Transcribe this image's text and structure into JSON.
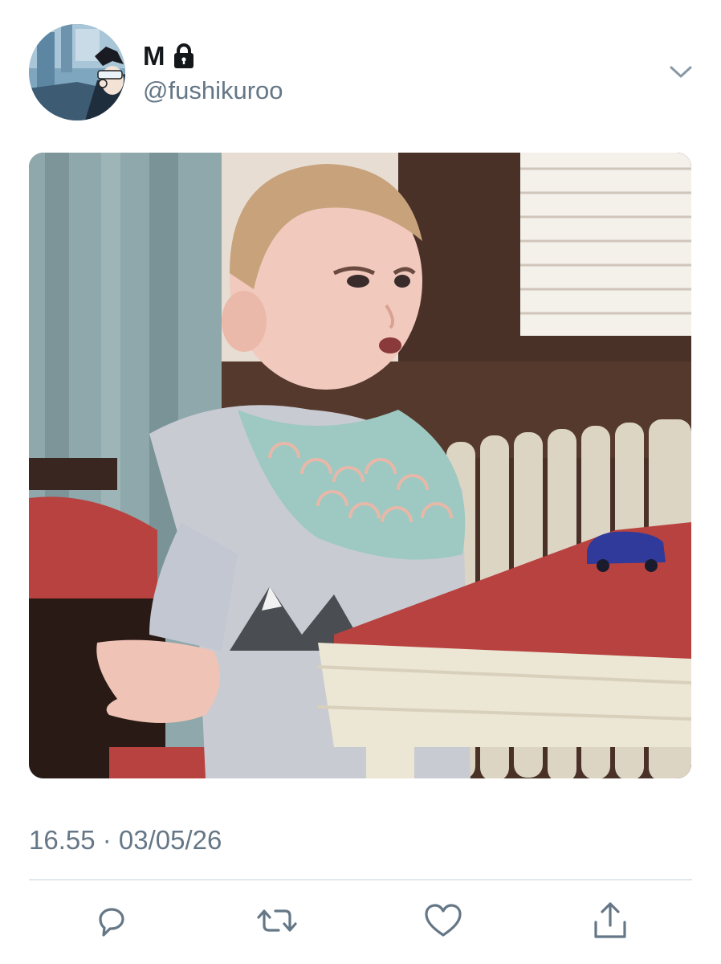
{
  "tweet": {
    "author": {
      "display_name": "M",
      "handle": "@fushikuroo",
      "protected_icon": "lock-icon",
      "avatar": "anime-character-avatar"
    },
    "menu_icon": "chevron-down-icon",
    "media": {
      "kind": "photo",
      "subject": "toddler-shrugging-meme"
    },
    "timestamp": "16.55 · 03/05/26",
    "actions": [
      {
        "name": "reply",
        "icon": "reply-icon"
      },
      {
        "name": "retweet",
        "icon": "retweet-icon"
      },
      {
        "name": "like",
        "icon": "heart-icon"
      },
      {
        "name": "share",
        "icon": "share-icon"
      }
    ]
  },
  "colors": {
    "text_primary": "#14171a",
    "text_secondary": "#657786",
    "icon_gray": "#657786",
    "divider": "#e1e8ed",
    "background": "#ffffff"
  }
}
